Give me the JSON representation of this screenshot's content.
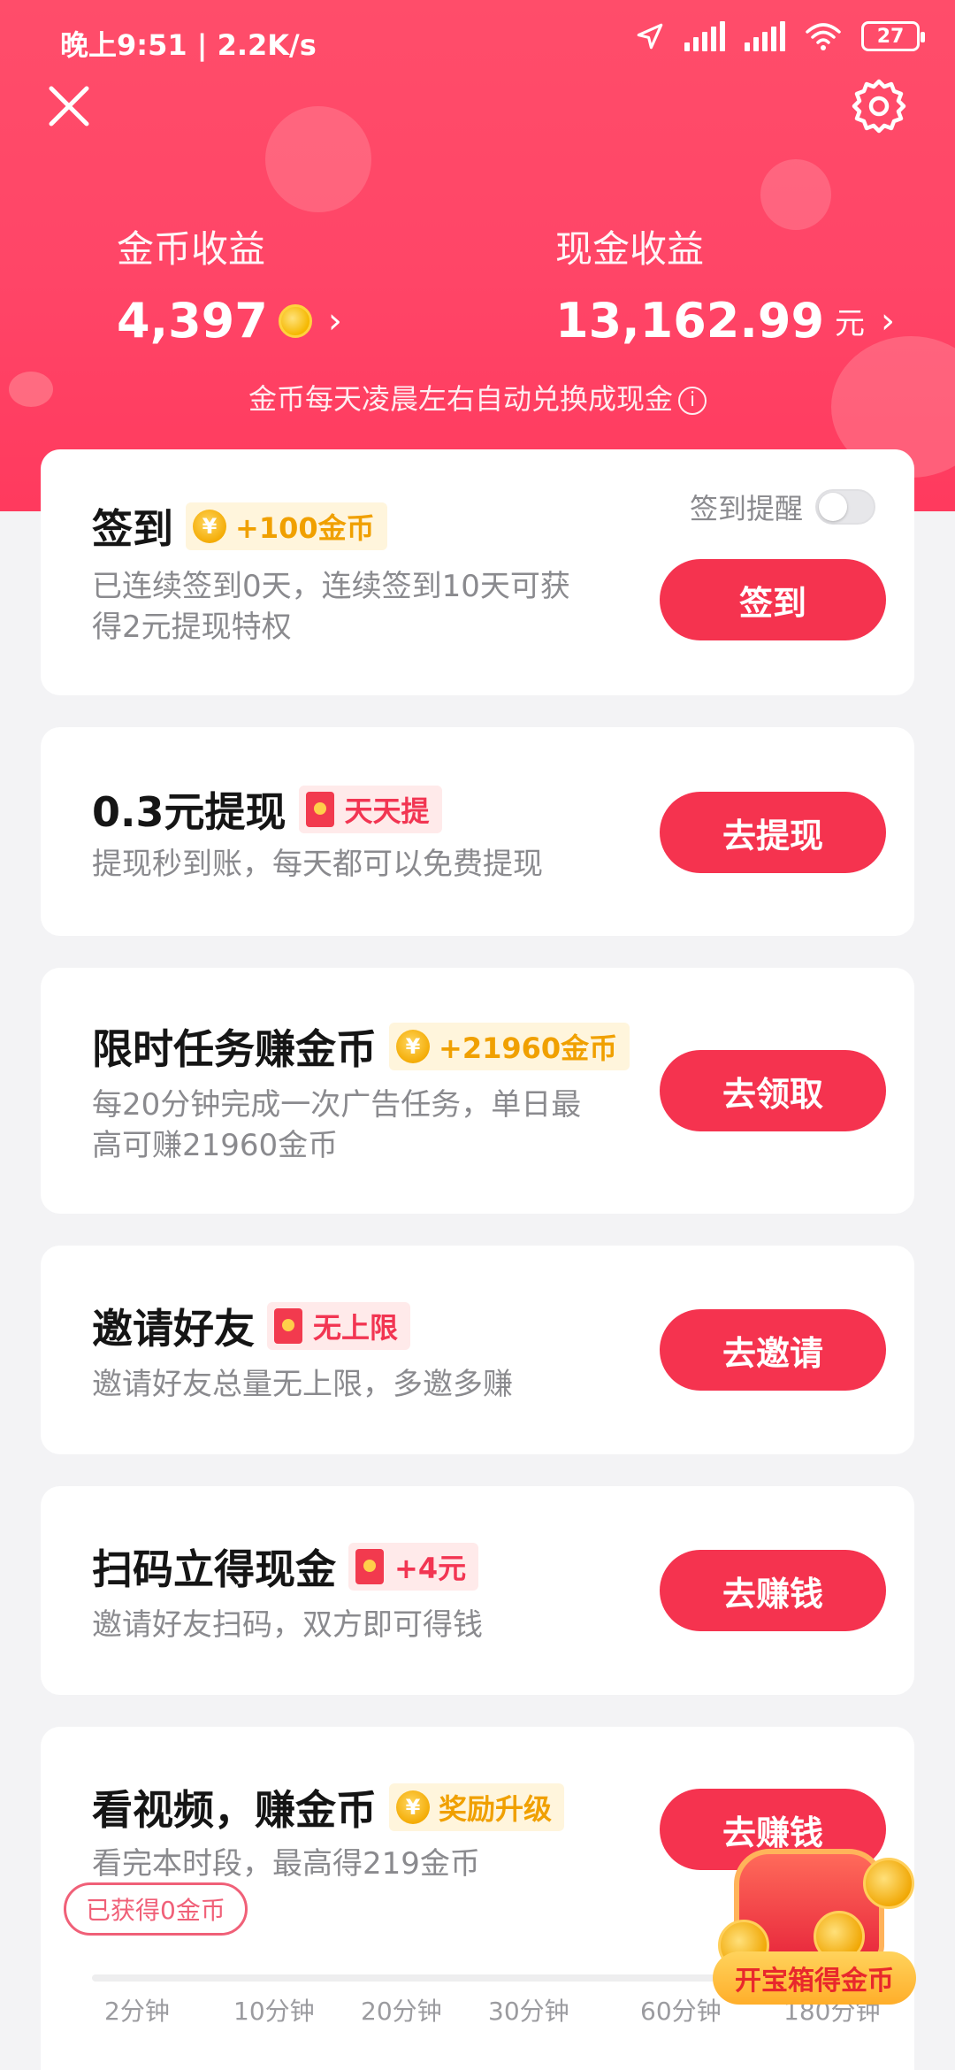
{
  "status_bar": {
    "time": "晚上9:51 | 2.2K/s",
    "battery": "27"
  },
  "header": {
    "coin_earnings_label": "金币收益",
    "coin_earnings_value": "4,397",
    "cash_earnings_label": "现金收益",
    "cash_earnings_value": "13,162.99",
    "cash_unit": "元",
    "hint": "金币每天凌晨左右自动兑换成现金"
  },
  "tasks": [
    {
      "title": "签到",
      "badge": "+100金币",
      "badge_type": "coin",
      "desc_line1": "已连续签到0天，连续签到10天可获",
      "desc_line2": "得2元提现特权",
      "button": "签到",
      "remind_label": "签到提醒",
      "remind_on": false
    },
    {
      "title": "0.3元提现",
      "badge": "天天提",
      "badge_type": "envelope",
      "desc_line1": "提现秒到账，每天都可以免费提现",
      "button": "去提现"
    },
    {
      "title": "限时任务赚金币",
      "badge": "+21960金币",
      "badge_type": "coin",
      "desc_line1": "每20分钟完成一次广告任务，单日最",
      "desc_line2": "高可赚21960金币",
      "button": "去领取"
    },
    {
      "title": "邀请好友",
      "badge": "无上限",
      "badge_type": "envelope",
      "desc_line1": "邀请好友总量无上限，多邀多赚",
      "button": "去邀请"
    },
    {
      "title": "扫码立得现金",
      "badge": "+4元",
      "badge_type": "envelope",
      "desc_line1": "邀请好友扫码，双方即可得钱",
      "button": "去赚钱"
    },
    {
      "title": "看视频，赚金币",
      "badge": "奖励升级",
      "badge_type": "coin",
      "desc_line1": "看完本时段，最高得219金币",
      "button": "去赚钱",
      "earned_pill": "已获得0金币",
      "ticks": [
        "2分钟",
        "10分钟",
        "20分钟",
        "30分钟",
        "60分钟",
        "180分钟"
      ]
    }
  ],
  "treasure_chest": {
    "label": "开宝箱得金币"
  },
  "colors": {
    "brand_red": "#f5334f",
    "header_red": "#ff4567",
    "coin_gold": "#f0a000"
  }
}
